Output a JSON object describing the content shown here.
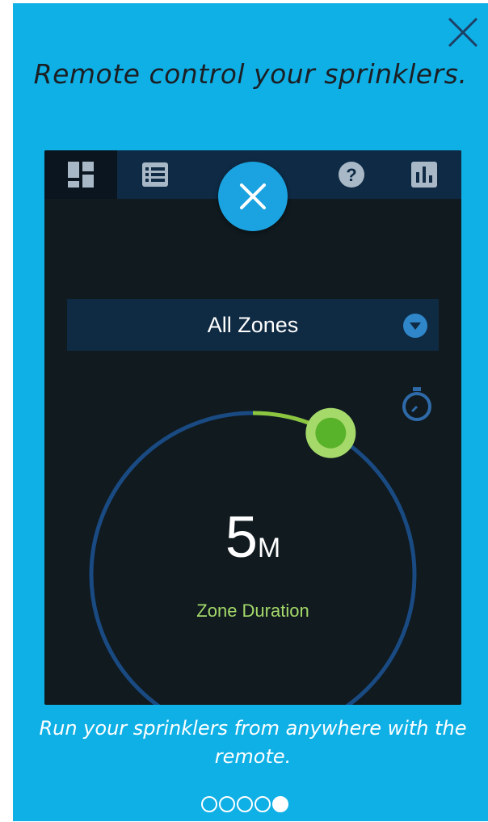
{
  "headline": "Remote control your sprinklers.",
  "body_text": "Run your sprinklers from anywhere with the remote.",
  "colors": {
    "panel_background": "#0fb0e6",
    "phone_background": "#101a1f",
    "toolbar_background": "#0e2a45",
    "fab": "#1aa3e0",
    "dial_track": "#1a4a82",
    "dial_progress": "#8dc63f",
    "caption": "#a5d96a"
  },
  "icons": {
    "close": "close-x-icon",
    "dashboard": "dashboard-icon",
    "list": "list-icon",
    "help": "help-icon",
    "stats": "bar-chart-icon",
    "fab": "close-x-icon",
    "dropdown": "chevron-down-icon",
    "timer": "stopwatch-icon"
  },
  "app": {
    "zone_select": {
      "value": "All Zones"
    },
    "duration": {
      "value": "5",
      "unit": "M",
      "caption": "Zone Duration",
      "progress_fraction": 0.08
    }
  },
  "pager": {
    "count": 5,
    "active_index": 4
  }
}
